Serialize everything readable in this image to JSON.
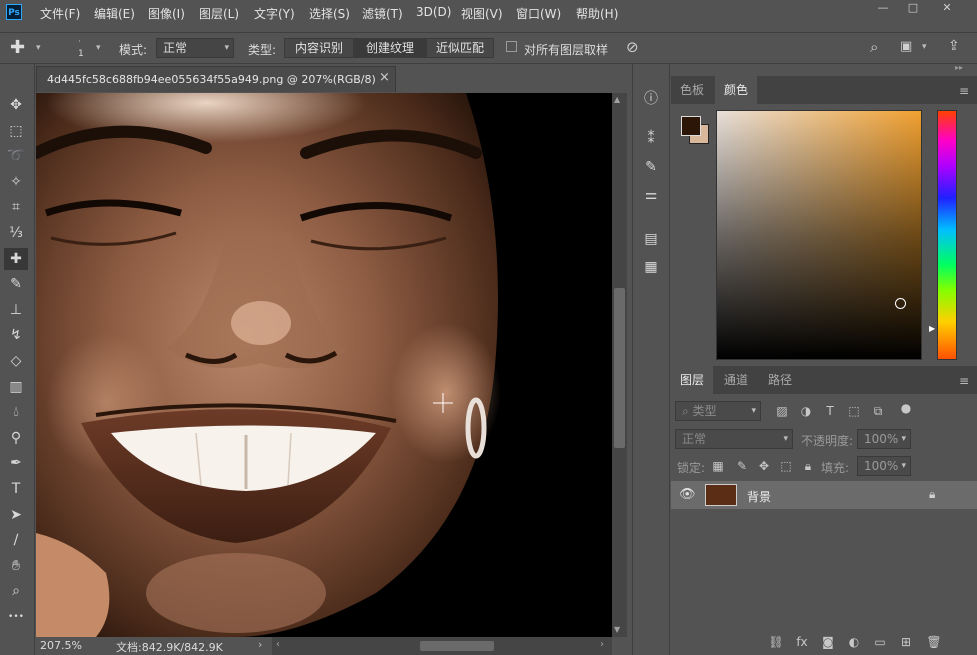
{
  "app": {
    "logo": "Ps"
  },
  "menu": [
    "文件(F)",
    "编辑(E)",
    "图像(I)",
    "图层(L)",
    "文字(Y)",
    "选择(S)",
    "滤镜(T)",
    "3D(D)",
    "视图(V)",
    "窗口(W)",
    "帮助(H)"
  ],
  "window_controls": [
    "—",
    "□",
    "✕"
  ],
  "options": {
    "brush_size": "1",
    "mode_label": "模式:",
    "mode_value": "正常",
    "type_label": "类型:",
    "type_options": [
      "内容识别",
      "创建纹理",
      "近似匹配"
    ],
    "type_selected": "创建纹理",
    "sample_all_label": "对所有图层取样"
  },
  "document": {
    "tab_title": "4d445fc58c688fb94ee055634f55a949.png @ 207%(RGB/8)",
    "close": "×",
    "zoom": "207.5%",
    "doc_info": "文档:842.9K/842.9K"
  },
  "tools": [
    "move-tool",
    "marquee-tool",
    "lasso-tool",
    "magic-wand-tool",
    "crop-tool",
    "eyedropper-tool",
    "healing-brush-tool",
    "brush-tool",
    "clone-stamp-tool",
    "history-brush-tool",
    "eraser-tool",
    "gradient-tool",
    "blur-tool",
    "dodge-tool",
    "pen-tool",
    "type-tool",
    "path-select-tool",
    "line-tool",
    "hand-tool",
    "zoom-tool",
    "more-tools"
  ],
  "color_panel": {
    "tabs": [
      "色板",
      "颜色"
    ],
    "active_tab": "颜色",
    "fg_color": "#2b1608",
    "bg_color": "#d9b79a"
  },
  "layers_panel": {
    "tabs": [
      "图层",
      "通道",
      "路径"
    ],
    "active_tab": "图层",
    "filter_label": "类型",
    "blend_mode": "正常",
    "opacity_label": "不透明度:",
    "opacity_value": "100%",
    "lock_label": "锁定:",
    "fill_label": "填充:",
    "fill_value": "100%",
    "layers": [
      {
        "name": "背景",
        "visible": true,
        "locked": true
      }
    ]
  },
  "colors": {
    "ui_bg": "#535353",
    "panel_dark": "#424242",
    "accent": "#31a8ff"
  }
}
